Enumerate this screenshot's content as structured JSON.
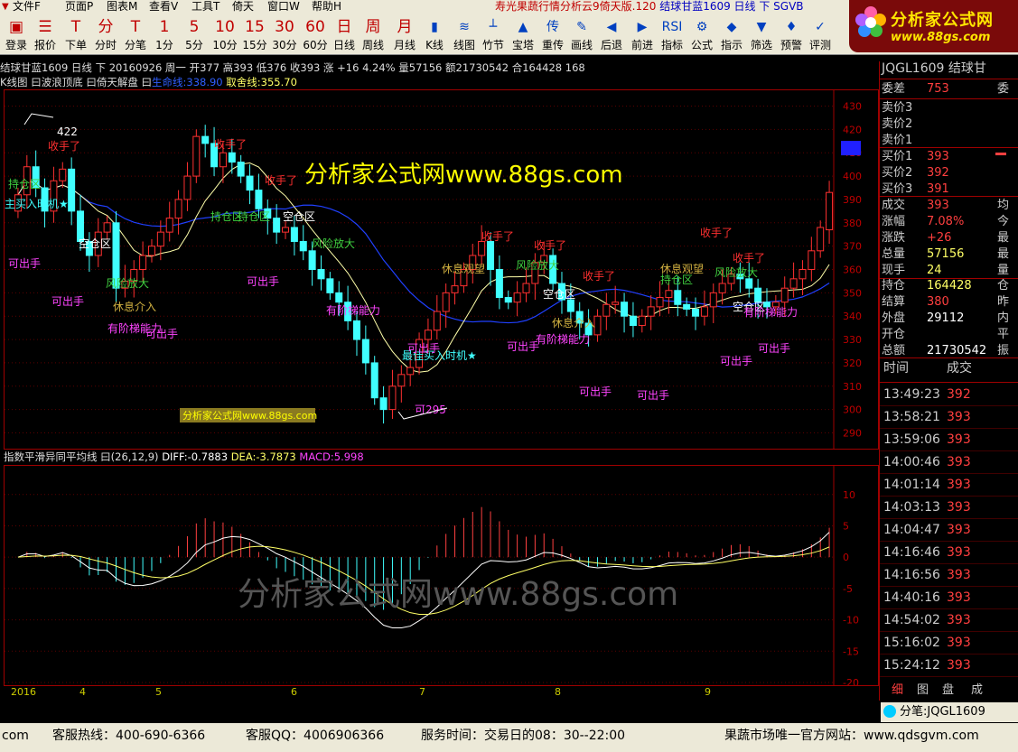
{
  "menu": {
    "items": [
      "文件F",
      "页面P",
      "图表M",
      "查看V",
      "工具T",
      "倚天",
      "窗口W",
      "帮助H"
    ],
    "title": "寿光果蔬行情分析云9倚天版.120",
    "title_contract": "结球甘蓝1609 日线 下 SGVB"
  },
  "toolbar": {
    "buttons": [
      {
        "icon": "▣",
        "label": "登录"
      },
      {
        "icon": "☰",
        "label": "报价"
      },
      {
        "icon": "T",
        "label": "下单"
      },
      {
        "icon": "分",
        "label": "分时"
      },
      {
        "icon": "T",
        "label": "分笔"
      },
      {
        "icon": "1",
        "label": "1分"
      },
      {
        "icon": "5",
        "label": "5分"
      },
      {
        "icon": "10",
        "label": "10分"
      },
      {
        "icon": "15",
        "label": "15分"
      },
      {
        "icon": "30",
        "label": "30分"
      },
      {
        "icon": "60",
        "label": "60分"
      },
      {
        "icon": "日",
        "label": "日线"
      },
      {
        "icon": "周",
        "label": "周线"
      },
      {
        "icon": "月",
        "label": "月线"
      },
      {
        "icon": "▮",
        "label": "K线"
      },
      {
        "icon": "≋",
        "label": "线图"
      },
      {
        "icon": "┴",
        "label": "竹节"
      },
      {
        "icon": "▲",
        "label": "宝塔"
      },
      {
        "icon": "传",
        "label": "重传"
      },
      {
        "icon": "✎",
        "label": "画线"
      },
      {
        "icon": "◀",
        "label": "后退"
      },
      {
        "icon": "▶",
        "label": "前进"
      },
      {
        "icon": "RSI",
        "label": "指标"
      },
      {
        "icon": "⚙",
        "label": "公式"
      },
      {
        "icon": "◆",
        "label": "指示"
      },
      {
        "icon": "▼",
        "label": "筛选"
      },
      {
        "icon": "♦",
        "label": "预警"
      },
      {
        "icon": "✓",
        "label": "评测"
      }
    ]
  },
  "logo": {
    "name": "分析家公式网",
    "url": "www.88gs.com"
  },
  "chart_info": {
    "line1": "结球甘蓝1609 日线 下  20160926 周一  开377  高393  低376  收393  涨 +16  4.24%  量57156  额21730542  合164428  168",
    "line2_prefix": "K线图  曰波浪顶底  曰倚天解盘  曰",
    "shengming": "生命线:338.90",
    "qushe": "取舍线:355.70",
    "macd_name": "指数平滑异同平均线  曰(26,12,9)",
    "diff": "DIFF:-0.7883",
    "dea": "DEA:-3.7873",
    "macd": "MACD:5.998"
  },
  "watermarks": {
    "main": "分析家公式网www.88gs.com",
    "box": "分析家公式网www.88gs.com",
    "macd": "分析家公式网www.88gs.com"
  },
  "chart_data": [
    {
      "type": "candlestick",
      "title": "结球甘蓝1609 日线",
      "y_ticks": [
        290,
        300,
        310,
        320,
        330,
        340,
        350,
        360,
        370,
        380,
        390,
        400,
        410,
        420,
        430
      ],
      "ylim": [
        284,
        436
      ],
      "x_months": [
        "2016",
        "4",
        "5",
        "6",
        "7",
        "8",
        "9"
      ],
      "closes": [
        392,
        404,
        395,
        385,
        398,
        403,
        385,
        372,
        366,
        376,
        380,
        352,
        355,
        360,
        366,
        370,
        376,
        382,
        390,
        400,
        417,
        414,
        404,
        410,
        406,
        400,
        394,
        386,
        382,
        376,
        378,
        372,
        368,
        360,
        356,
        350,
        346,
        338,
        330,
        320,
        305,
        300,
        310,
        315,
        318,
        330,
        334,
        342,
        350,
        353,
        360,
        366,
        372,
        360,
        348,
        346,
        350,
        354,
        363,
        366,
        354,
        347,
        342,
        337,
        332,
        340,
        345,
        346,
        340,
        336,
        340,
        344,
        348,
        351,
        345,
        343,
        340,
        344,
        350,
        354,
        358,
        356,
        352,
        346,
        344,
        346,
        352,
        356,
        360,
        368,
        378,
        393
      ],
      "opens": [
        385,
        392,
        404,
        395,
        385,
        398,
        403,
        385,
        372,
        366,
        376,
        380,
        352,
        355,
        360,
        366,
        370,
        376,
        382,
        390,
        400,
        417,
        414,
        404,
        410,
        406,
        400,
        394,
        386,
        382,
        376,
        378,
        372,
        368,
        360,
        356,
        350,
        346,
        338,
        330,
        320,
        305,
        300,
        310,
        315,
        318,
        330,
        334,
        342,
        350,
        353,
        360,
        366,
        372,
        360,
        348,
        346,
        350,
        354,
        363,
        366,
        354,
        347,
        342,
        337,
        332,
        340,
        345,
        346,
        340,
        336,
        340,
        344,
        348,
        351,
        345,
        343,
        340,
        344,
        350,
        354,
        358,
        356,
        352,
        346,
        344,
        346,
        352,
        356,
        360,
        368,
        377
      ],
      "annotations": [
        "422",
        "收手了",
        "持仓区",
        "主买入时机★",
        "空仓区",
        "可出手",
        "风险放大",
        "可出手",
        "休息介入",
        "有阶梯能力",
        "可出手",
        "收手了",
        "持仓区",
        "可出手",
        "收手了",
        "空仓区",
        "风险放大",
        "有阶梯能力",
        "持仓区",
        "最佳买入时机★",
        "可出手",
        "可295",
        "收手了",
        "休息观望",
        "风险放大",
        "收手了",
        "空仓区",
        "休息介入",
        "收手了",
        "可出手",
        "有阶梯能力",
        "可出手",
        "可出手",
        "收手了",
        "休息观望",
        "持仓区",
        "风险放大",
        "收手了",
        "空仓区",
        "有阶梯能力",
        "可出手",
        "可出手"
      ]
    },
    {
      "type": "bar",
      "title": "MACD",
      "y_ticks": [
        10,
        5,
        0,
        -5,
        -10,
        -15,
        -20
      ],
      "ylim": [
        -20,
        14
      ]
    }
  ],
  "panel": {
    "title": "JQGL1609 结球甘",
    "weicha_label": "委差",
    "weicha": "753",
    "weicha_right": "委",
    "sell": [
      {
        "k": "卖价3",
        "v": ""
      },
      {
        "k": "卖价2",
        "v": ""
      },
      {
        "k": "卖价1",
        "v": ""
      }
    ],
    "buy": [
      {
        "k": "买价1",
        "v": "393"
      },
      {
        "k": "买价2",
        "v": "392"
      },
      {
        "k": "买价3",
        "v": "391"
      }
    ],
    "stats": [
      {
        "k": "成交",
        "v": "393",
        "x": "均"
      },
      {
        "k": "涨幅",
        "v": "7.08%",
        "x": "今"
      },
      {
        "k": "涨跌",
        "v": "+26",
        "x": "最"
      },
      {
        "k": "总量",
        "v": "57156",
        "x": "最"
      },
      {
        "k": "现手",
        "v": "24",
        "x": "量"
      }
    ],
    "stats2": [
      {
        "k": "持仓",
        "v": "164428",
        "x": "仓"
      },
      {
        "k": "结算",
        "v": "380",
        "x": "昨"
      },
      {
        "k": "外盘",
        "v": "29112",
        "x": "内"
      },
      {
        "k": "开仓",
        "v": "",
        "x": "平"
      },
      {
        "k": "总额",
        "v": "21730542",
        "x": "振"
      }
    ],
    "tick_header_time": "时间",
    "tick_header_vol": "成交",
    "ticks": [
      {
        "t": "13:49:23",
        "p": "392"
      },
      {
        "t": "13:58:21",
        "p": "393"
      },
      {
        "t": "13:59:06",
        "p": "393"
      },
      {
        "t": "14:00:46",
        "p": "393"
      },
      {
        "t": "14:01:14",
        "p": "393"
      },
      {
        "t": "14:03:13",
        "p": "393"
      },
      {
        "t": "14:04:47",
        "p": "393"
      },
      {
        "t": "14:16:46",
        "p": "393"
      },
      {
        "t": "14:16:56",
        "p": "393"
      },
      {
        "t": "14:40:16",
        "p": "393"
      },
      {
        "t": "14:54:02",
        "p": "393"
      },
      {
        "t": "15:16:02",
        "p": "393"
      },
      {
        "t": "15:24:12",
        "p": "393"
      }
    ],
    "tabs": [
      "细",
      "图",
      "盘",
      "成"
    ],
    "fenbi": "分笔:JQGL1609"
  },
  "status": {
    "com": "com",
    "hotline": "客服热线：400-690-6366",
    "qq": "客服QQ：4006906366",
    "service": "服务时间：交易日的08：30--22:00",
    "site": "果蔬市场唯一官方网站：www.qdsgvm.com"
  }
}
